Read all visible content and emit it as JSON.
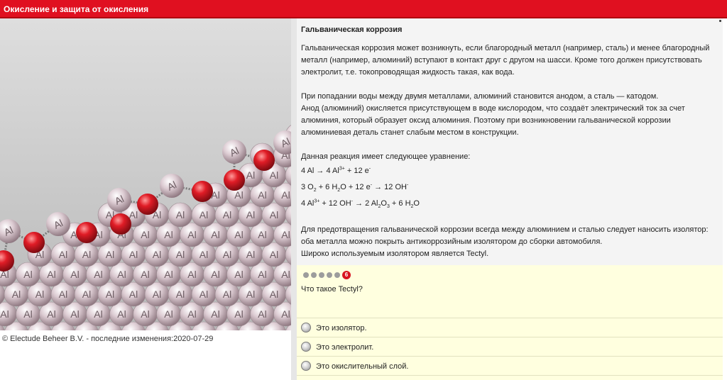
{
  "header": {
    "title": "Окисление и защита от окисления"
  },
  "illustration": {
    "icon": "al-oxide-molecule-illustration",
    "atom_label": "Al",
    "colors": {
      "aluminium": "#d8c6ce",
      "oxygen": "#d81a24",
      "background": "#c9c9c9"
    }
  },
  "footer": {
    "copyright": "© Electude Beheer B.V. - последние изменения:2020-07-29"
  },
  "article": {
    "heading": "Гальваническая коррозия",
    "p1": "Гальваническая коррозия может возникнуть, если благородный металл (например, сталь) и менее благородный металл (например, алюминий) вступают в контакт друг с другом на шасси. Кроме того должен присутствовать электролит, т.е. токопроводящая жидкость такая, как вода.",
    "p2a": "При попадании воды между двумя металлами, алюминий становится анодом, а сталь — катодом.",
    "p2b": "Анод (алюминий) окисляется присутствующем в воде кислородом, что создаёт электрический ток за счет алюминия, который образует оксид алюминия. Поэтому при возникновении гальванической коррозии алюминиевая деталь станет слабым местом в конструкции.",
    "eq_intro": "Данная реакция имеет следующее уравнение:",
    "p3a": "Для предотвращения гальванической коррозии всегда между алюминием и сталью следует наносить изолятор: оба металла можно покрыть антикоррозийным изолятором до сборки автомобиля.",
    "p3b": "Широко используемым изолятором является Tectyl."
  },
  "quiz": {
    "progress_total": 6,
    "current_step": "6",
    "question": "Что такое Tectyl?",
    "answers": [
      "Это изолятор.",
      "Это электролит.",
      "Это окислительный слой."
    ],
    "colors": {
      "panel": "#ffffdf",
      "badge": "#d8141e"
    }
  },
  "colors": {
    "titlebar": "#e01020"
  }
}
